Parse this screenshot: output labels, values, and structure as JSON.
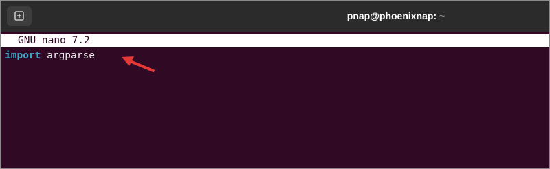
{
  "window": {
    "title": "pnap@phoenixnap: ~"
  },
  "toolbar": {
    "new_tab_icon": "new-tab-icon"
  },
  "nano": {
    "header": "GNU nano 7.2"
  },
  "editor": {
    "lines": [
      {
        "keyword": "import",
        "rest": " argparse"
      }
    ]
  },
  "colors": {
    "terminal_bg": "#300a24",
    "titlebar_bg": "#2b2b2b",
    "keyword": "#3aa7c7",
    "arrow": "#e53935"
  }
}
